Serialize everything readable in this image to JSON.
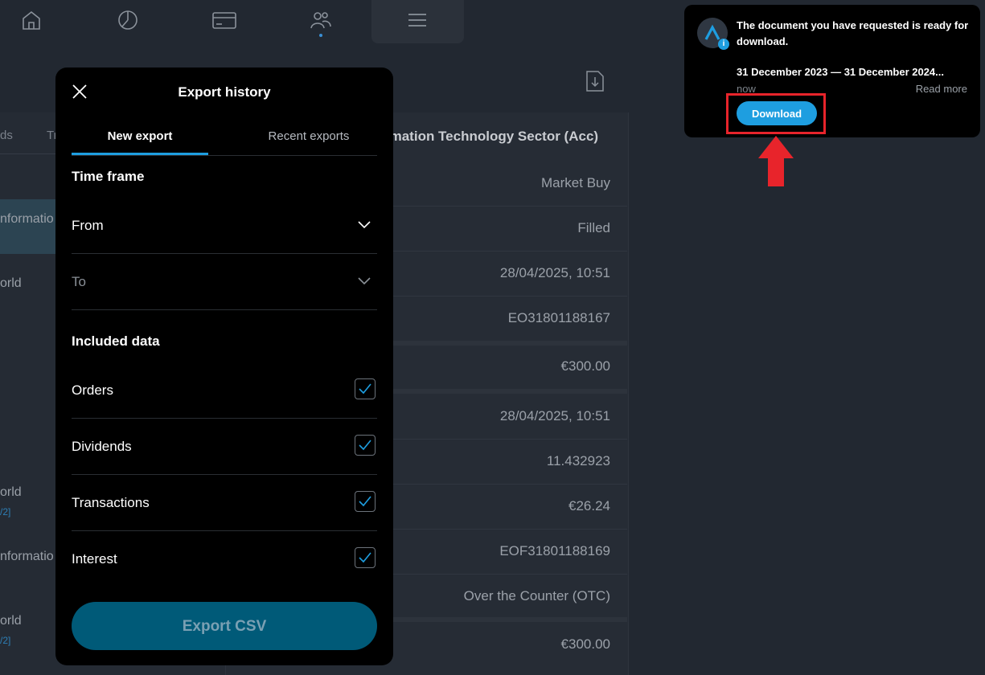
{
  "nav": {
    "icons": [
      "home-icon",
      "pie-chart-icon",
      "card-icon",
      "people-icon",
      "menu-icon"
    ]
  },
  "left_list": {
    "tab_1": "ds",
    "tab_2": "Tr",
    "rows": [
      {
        "text": "nformatio"
      },
      {
        "text": "orld"
      },
      {
        "text": "orld",
        "sub": "/2]"
      },
      {
        "text": "nformatio"
      },
      {
        "text": "orld",
        "sub": "/2]"
      }
    ]
  },
  "detail": {
    "title": "rmation Technology Sector (Acc)",
    "rows": [
      "Market Buy",
      "Filled",
      "28/04/2025, 10:51",
      "EO31801188167",
      "€300.00",
      "28/04/2025, 10:51",
      "11.432923",
      "€26.24",
      "EOF31801188169",
      "Over the Counter (OTC)",
      "€300.00"
    ]
  },
  "modal": {
    "title": "Export history",
    "tabs": {
      "new": "New export",
      "recent": "Recent exports"
    },
    "time_frame_title": "Time frame",
    "from_label": "From",
    "to_label": "To",
    "included_title": "Included data",
    "options": [
      {
        "label": "Orders",
        "checked": true
      },
      {
        "label": "Dividends",
        "checked": true
      },
      {
        "label": "Transactions",
        "checked": true
      },
      {
        "label": "Interest",
        "checked": true
      }
    ],
    "export_button": "Export CSV"
  },
  "notification": {
    "badge": "i",
    "message": "The document you have requested is ready for download.",
    "range": "31 December 2023 — 31 December 2024...",
    "time": "now",
    "read_more": "Read more",
    "download": "Download"
  },
  "colors": {
    "accent": "#1e9ee0",
    "highlight": "#e8242b",
    "export_button": "#005a78"
  }
}
